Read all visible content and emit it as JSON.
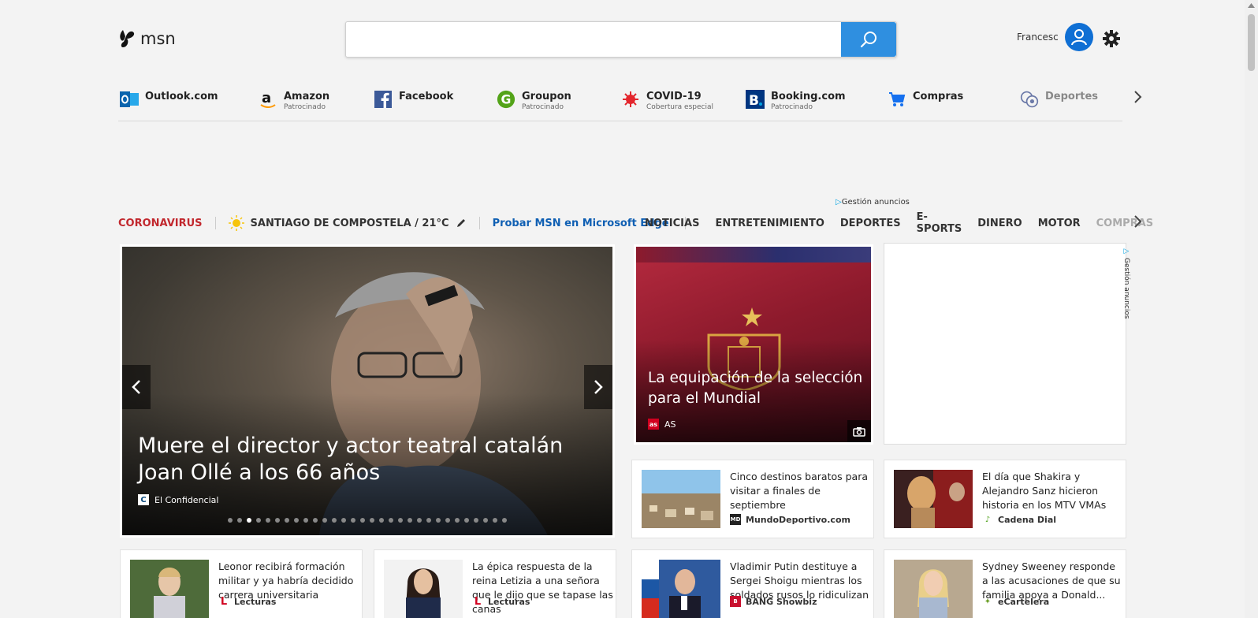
{
  "header": {
    "logo_text": "msn",
    "search_placeholder": "",
    "user_name": "Francesc"
  },
  "quicklinks": [
    {
      "label": "Outlook.com",
      "sub": "",
      "icon": "outlook-icon"
    },
    {
      "label": "Amazon",
      "sub": "Patrocinado",
      "icon": "amazon-icon"
    },
    {
      "label": "Facebook",
      "sub": "",
      "icon": "facebook-icon"
    },
    {
      "label": "Groupon",
      "sub": "Patrocinado",
      "icon": "groupon-icon"
    },
    {
      "label": "COVID-19",
      "sub": "Cobertura especial",
      "icon": "virus-icon"
    },
    {
      "label": "Booking.com",
      "sub": "Patrocinado",
      "icon": "booking-icon"
    },
    {
      "label": "Compras",
      "sub": "",
      "icon": "cart-icon"
    },
    {
      "label": "Deportes",
      "sub": "",
      "icon": "sports-icon"
    }
  ],
  "ads": {
    "gestion_label": "Gestión anuncios"
  },
  "nav": {
    "coronavirus": "CORONAVIRUS",
    "weather": "SANTIAGO DE COMPOSTELA / 21°C",
    "edge_promo": "Probar MSN en Microsoft Edge",
    "categories": [
      "NOTICIAS",
      "ENTRETENIMIENTO",
      "DEPORTES",
      "E-SPORTS",
      "DINERO",
      "MOTOR",
      "COMPRAS"
    ]
  },
  "hero": {
    "title": "Muere el director y actor teatral catalán Joan Ollé a los 66 años",
    "source": "El Confidencial",
    "slide_index": 3,
    "slide_count": 30
  },
  "feature": {
    "title": "La equipación de la selección para el Mundial",
    "source": "AS"
  },
  "cards": [
    {
      "title": "Cinco destinos baratos para visitar a finales de septiembre",
      "source": "MundoDeportivo.com"
    },
    {
      "title": "El día que Shakira y Alejandro Sanz hicieron historia en los MTV VMAs",
      "source": "Cadena Dial"
    },
    {
      "title": "Leonor recibirá formación militar y ya habría decidido carrera universitaria",
      "source": "Lecturas"
    },
    {
      "title": "La épica respuesta de la reina Letizia a una señora que le dijo que se tapase las canas",
      "source": "Lecturas"
    },
    {
      "title": "Vladimir Putin destituye a Sergei Shoigu mientras los soldados rusos lo ridiculizan",
      "source": "BANG Showbiz"
    },
    {
      "title": "Sydney Sweeney responde a las acusaciones de que su familia apoya a Donald...",
      "source": "eCartelera"
    }
  ],
  "colors": {
    "accent": "#2f8fe0",
    "corona": "#c1272d",
    "edge_link": "#0f5fb3"
  }
}
